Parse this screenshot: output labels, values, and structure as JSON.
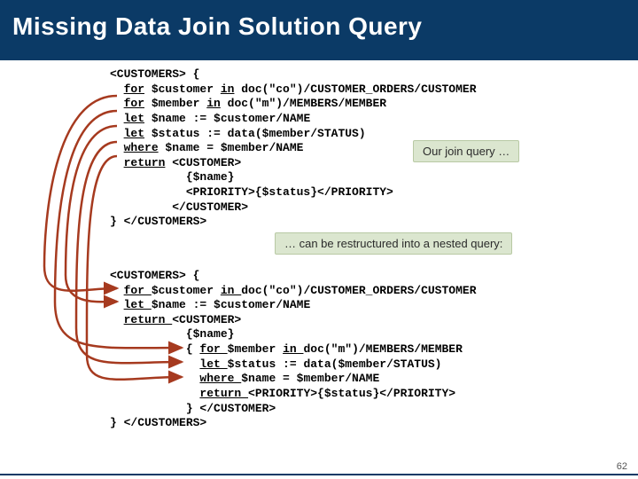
{
  "slide": {
    "title": "Missing Data Join Solution Query",
    "number": "62"
  },
  "code1": {
    "l1a": "<CUSTOMERS> {",
    "l2a": "  ",
    "l2k1": "for",
    "l2b": " $customer ",
    "l2k2": "in",
    "l2c": " doc(\"co\")/CUSTOMER_ORDERS/CUSTOMER",
    "l3a": "  ",
    "l3k1": "for",
    "l3b": " $member ",
    "l3k2": "in",
    "l3c": " doc(\"m\")/MEMBERS/MEMBER",
    "l4a": "  ",
    "l4k1": "let",
    "l4b": " $name := $customer/NAME",
    "l5a": "  ",
    "l5k1": "let",
    "l5b": " $status := data($member/STATUS)",
    "l6a": "  ",
    "l6k1": "where",
    "l6b": " $name = $member/NAME",
    "l7a": "  ",
    "l7k1": "return",
    "l7b": " <CUSTOMER>",
    "l8": "           {$name}",
    "l9": "           <PRIORITY>{$status}</PRIORITY>",
    "l10": "         </CUSTOMER>",
    "l11": "} </CUSTOMERS>"
  },
  "code2": {
    "l1a": "<CUSTOMERS> {",
    "l2a": "  ",
    "l2k1": "for ",
    "l2b": "$customer ",
    "l2k2": "in ",
    "l2c": "doc(\"co\")/CUSTOMER_ORDERS/CUSTOMER",
    "l3a": "  ",
    "l3k1": "let ",
    "l3b": "$name := $customer/NAME",
    "l4a": "  ",
    "l4k1": "return ",
    "l4b": "<CUSTOMER>",
    "l5": "           {$name}",
    "l6a": "           { ",
    "l6k1": "for ",
    "l6b": "$member ",
    "l6k2": "in ",
    "l6c": "doc(\"m\")/MEMBERS/MEMBER",
    "l7a": "             ",
    "l7k1": "let ",
    "l7b": "$status := data($member/STATUS)",
    "l8a": "             ",
    "l8k1": "where ",
    "l8b": "$name = $member/NAME",
    "l9a": "             ",
    "l9k1": "return ",
    "l9b": "<PRIORITY>{$status}</PRIORITY>",
    "l10": "           } </CUSTOMER>",
    "l11": "} </CUSTOMERS>"
  },
  "annot": {
    "a1": "Our join query …",
    "a2": "… can be restructured into a nested query:"
  }
}
